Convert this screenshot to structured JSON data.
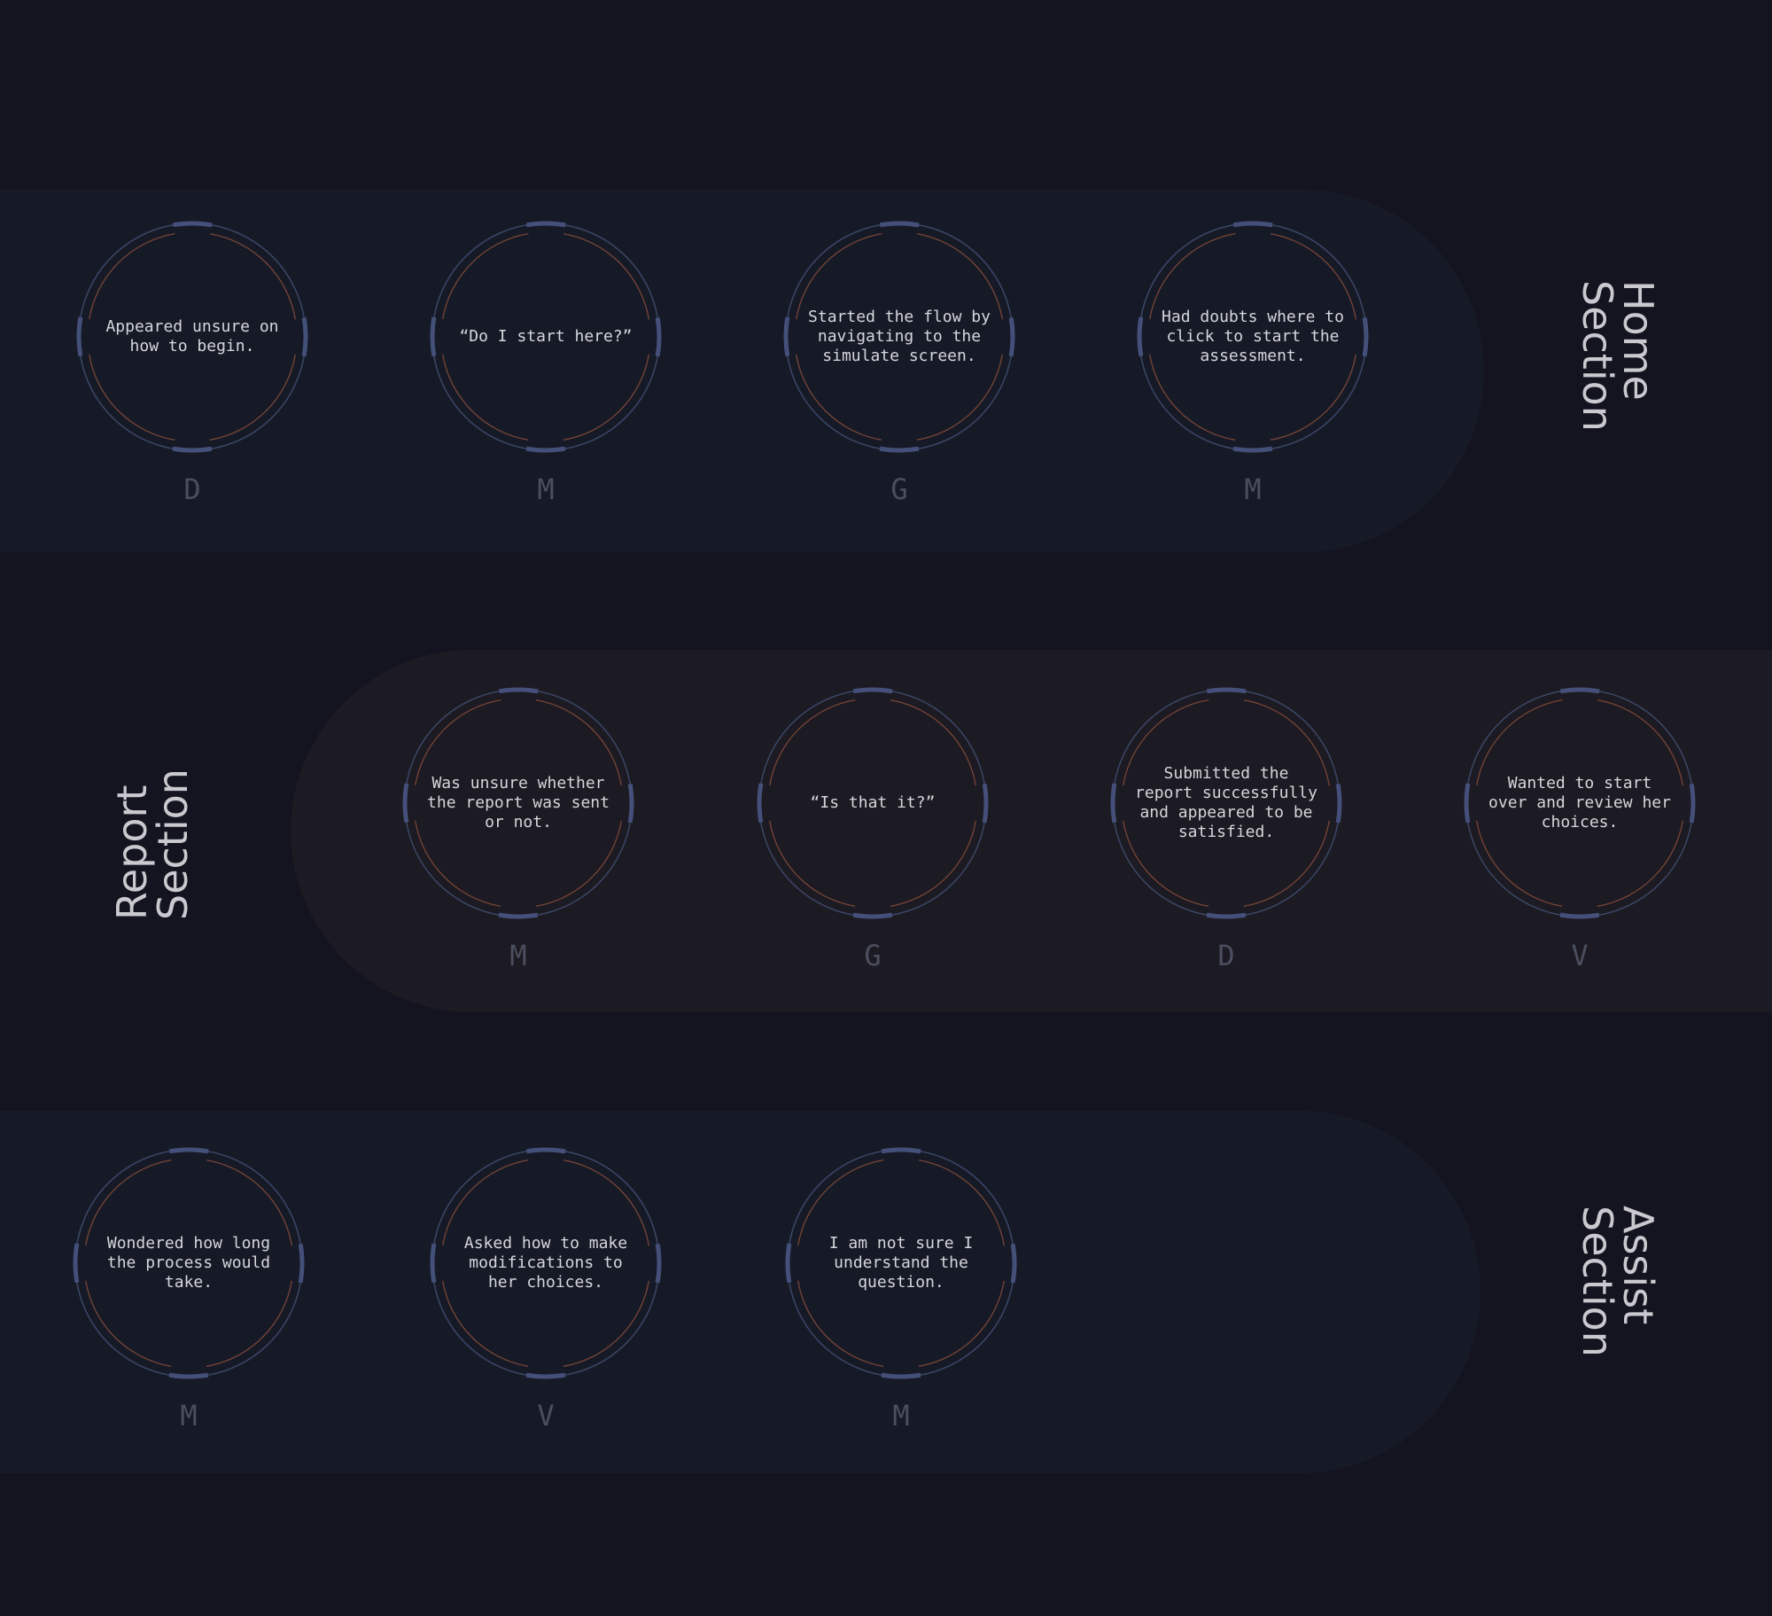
{
  "colors": {
    "background": "#13141f",
    "band_home": "#161a27",
    "band_report": "#1c1a22",
    "ring": "#3a4564",
    "ring_cap": "#44507a",
    "inner_arc": "#774537"
  },
  "sections": [
    {
      "id": "home",
      "label_line1": "Home",
      "label_line2": "Section",
      "cards": [
        {
          "text": "Appeared unsure on how to begin.",
          "participant": "D"
        },
        {
          "text": "“Do I start here?”",
          "participant": "M"
        },
        {
          "text": "Started the flow by navigating to the simulate screen.",
          "participant": "G"
        },
        {
          "text": "Had doubts where to click to start the assessment.",
          "participant": "M"
        }
      ]
    },
    {
      "id": "report",
      "label_line1": "Report",
      "label_line2": "Section",
      "cards": [
        {
          "text": "Was unsure whether the report was sent or not.",
          "participant": "M"
        },
        {
          "text": "“Is that it?”",
          "participant": "G"
        },
        {
          "text": "Submitted the report successfully and appeared to be satisfied.",
          "participant": "D"
        },
        {
          "text": "Wanted to start over and review her choices.",
          "participant": "V"
        }
      ]
    },
    {
      "id": "assist",
      "label_line1": "Assist",
      "label_line2": "Section",
      "cards": [
        {
          "text": "Wondered how long the process would take.",
          "participant": "M"
        },
        {
          "text": "Asked how to make modifications to her choices.",
          "participant": "V"
        },
        {
          "text": "I am not sure I understand the question.",
          "participant": "M"
        }
      ]
    }
  ]
}
